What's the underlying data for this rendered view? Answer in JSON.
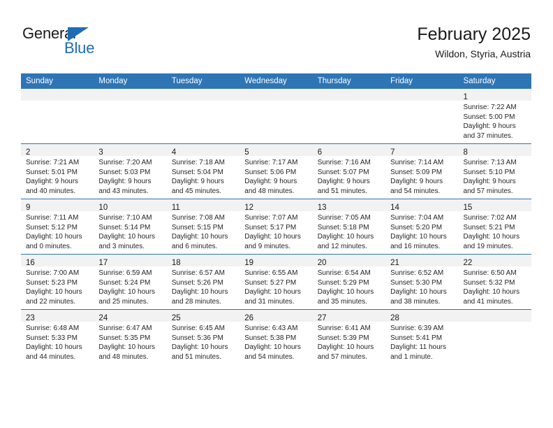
{
  "branding": {
    "logo_text_primary": "General",
    "logo_text_secondary": "Blue",
    "logo_accent_color": "#1f6cb4"
  },
  "header": {
    "title": "February 2025",
    "subtitle": "Wildon, Styria, Austria"
  },
  "theme": {
    "header_bar_color": "#2e75b6",
    "daynum_band_color": "#f2f2f2",
    "text_color": "#1a1a1a"
  },
  "weekday_headers": [
    "Sunday",
    "Monday",
    "Tuesday",
    "Wednesday",
    "Thursday",
    "Friday",
    "Saturday"
  ],
  "weeks": [
    [
      {
        "day": "",
        "sunrise": "",
        "sunset": "",
        "daylight1": "",
        "daylight2": ""
      },
      {
        "day": "",
        "sunrise": "",
        "sunset": "",
        "daylight1": "",
        "daylight2": ""
      },
      {
        "day": "",
        "sunrise": "",
        "sunset": "",
        "daylight1": "",
        "daylight2": ""
      },
      {
        "day": "",
        "sunrise": "",
        "sunset": "",
        "daylight1": "",
        "daylight2": ""
      },
      {
        "day": "",
        "sunrise": "",
        "sunset": "",
        "daylight1": "",
        "daylight2": ""
      },
      {
        "day": "",
        "sunrise": "",
        "sunset": "",
        "daylight1": "",
        "daylight2": ""
      },
      {
        "day": "1",
        "sunrise": "Sunrise: 7:22 AM",
        "sunset": "Sunset: 5:00 PM",
        "daylight1": "Daylight: 9 hours",
        "daylight2": "and 37 minutes."
      }
    ],
    [
      {
        "day": "2",
        "sunrise": "Sunrise: 7:21 AM",
        "sunset": "Sunset: 5:01 PM",
        "daylight1": "Daylight: 9 hours",
        "daylight2": "and 40 minutes."
      },
      {
        "day": "3",
        "sunrise": "Sunrise: 7:20 AM",
        "sunset": "Sunset: 5:03 PM",
        "daylight1": "Daylight: 9 hours",
        "daylight2": "and 43 minutes."
      },
      {
        "day": "4",
        "sunrise": "Sunrise: 7:18 AM",
        "sunset": "Sunset: 5:04 PM",
        "daylight1": "Daylight: 9 hours",
        "daylight2": "and 45 minutes."
      },
      {
        "day": "5",
        "sunrise": "Sunrise: 7:17 AM",
        "sunset": "Sunset: 5:06 PM",
        "daylight1": "Daylight: 9 hours",
        "daylight2": "and 48 minutes."
      },
      {
        "day": "6",
        "sunrise": "Sunrise: 7:16 AM",
        "sunset": "Sunset: 5:07 PM",
        "daylight1": "Daylight: 9 hours",
        "daylight2": "and 51 minutes."
      },
      {
        "day": "7",
        "sunrise": "Sunrise: 7:14 AM",
        "sunset": "Sunset: 5:09 PM",
        "daylight1": "Daylight: 9 hours",
        "daylight2": "and 54 minutes."
      },
      {
        "day": "8",
        "sunrise": "Sunrise: 7:13 AM",
        "sunset": "Sunset: 5:10 PM",
        "daylight1": "Daylight: 9 hours",
        "daylight2": "and 57 minutes."
      }
    ],
    [
      {
        "day": "9",
        "sunrise": "Sunrise: 7:11 AM",
        "sunset": "Sunset: 5:12 PM",
        "daylight1": "Daylight: 10 hours",
        "daylight2": "and 0 minutes."
      },
      {
        "day": "10",
        "sunrise": "Sunrise: 7:10 AM",
        "sunset": "Sunset: 5:14 PM",
        "daylight1": "Daylight: 10 hours",
        "daylight2": "and 3 minutes."
      },
      {
        "day": "11",
        "sunrise": "Sunrise: 7:08 AM",
        "sunset": "Sunset: 5:15 PM",
        "daylight1": "Daylight: 10 hours",
        "daylight2": "and 6 minutes."
      },
      {
        "day": "12",
        "sunrise": "Sunrise: 7:07 AM",
        "sunset": "Sunset: 5:17 PM",
        "daylight1": "Daylight: 10 hours",
        "daylight2": "and 9 minutes."
      },
      {
        "day": "13",
        "sunrise": "Sunrise: 7:05 AM",
        "sunset": "Sunset: 5:18 PM",
        "daylight1": "Daylight: 10 hours",
        "daylight2": "and 12 minutes."
      },
      {
        "day": "14",
        "sunrise": "Sunrise: 7:04 AM",
        "sunset": "Sunset: 5:20 PM",
        "daylight1": "Daylight: 10 hours",
        "daylight2": "and 16 minutes."
      },
      {
        "day": "15",
        "sunrise": "Sunrise: 7:02 AM",
        "sunset": "Sunset: 5:21 PM",
        "daylight1": "Daylight: 10 hours",
        "daylight2": "and 19 minutes."
      }
    ],
    [
      {
        "day": "16",
        "sunrise": "Sunrise: 7:00 AM",
        "sunset": "Sunset: 5:23 PM",
        "daylight1": "Daylight: 10 hours",
        "daylight2": "and 22 minutes."
      },
      {
        "day": "17",
        "sunrise": "Sunrise: 6:59 AM",
        "sunset": "Sunset: 5:24 PM",
        "daylight1": "Daylight: 10 hours",
        "daylight2": "and 25 minutes."
      },
      {
        "day": "18",
        "sunrise": "Sunrise: 6:57 AM",
        "sunset": "Sunset: 5:26 PM",
        "daylight1": "Daylight: 10 hours",
        "daylight2": "and 28 minutes."
      },
      {
        "day": "19",
        "sunrise": "Sunrise: 6:55 AM",
        "sunset": "Sunset: 5:27 PM",
        "daylight1": "Daylight: 10 hours",
        "daylight2": "and 31 minutes."
      },
      {
        "day": "20",
        "sunrise": "Sunrise: 6:54 AM",
        "sunset": "Sunset: 5:29 PM",
        "daylight1": "Daylight: 10 hours",
        "daylight2": "and 35 minutes."
      },
      {
        "day": "21",
        "sunrise": "Sunrise: 6:52 AM",
        "sunset": "Sunset: 5:30 PM",
        "daylight1": "Daylight: 10 hours",
        "daylight2": "and 38 minutes."
      },
      {
        "day": "22",
        "sunrise": "Sunrise: 6:50 AM",
        "sunset": "Sunset: 5:32 PM",
        "daylight1": "Daylight: 10 hours",
        "daylight2": "and 41 minutes."
      }
    ],
    [
      {
        "day": "23",
        "sunrise": "Sunrise: 6:48 AM",
        "sunset": "Sunset: 5:33 PM",
        "daylight1": "Daylight: 10 hours",
        "daylight2": "and 44 minutes."
      },
      {
        "day": "24",
        "sunrise": "Sunrise: 6:47 AM",
        "sunset": "Sunset: 5:35 PM",
        "daylight1": "Daylight: 10 hours",
        "daylight2": "and 48 minutes."
      },
      {
        "day": "25",
        "sunrise": "Sunrise: 6:45 AM",
        "sunset": "Sunset: 5:36 PM",
        "daylight1": "Daylight: 10 hours",
        "daylight2": "and 51 minutes."
      },
      {
        "day": "26",
        "sunrise": "Sunrise: 6:43 AM",
        "sunset": "Sunset: 5:38 PM",
        "daylight1": "Daylight: 10 hours",
        "daylight2": "and 54 minutes."
      },
      {
        "day": "27",
        "sunrise": "Sunrise: 6:41 AM",
        "sunset": "Sunset: 5:39 PM",
        "daylight1": "Daylight: 10 hours",
        "daylight2": "and 57 minutes."
      },
      {
        "day": "28",
        "sunrise": "Sunrise: 6:39 AM",
        "sunset": "Sunset: 5:41 PM",
        "daylight1": "Daylight: 11 hours",
        "daylight2": "and 1 minute."
      },
      {
        "day": "",
        "sunrise": "",
        "sunset": "",
        "daylight1": "",
        "daylight2": ""
      }
    ]
  ]
}
